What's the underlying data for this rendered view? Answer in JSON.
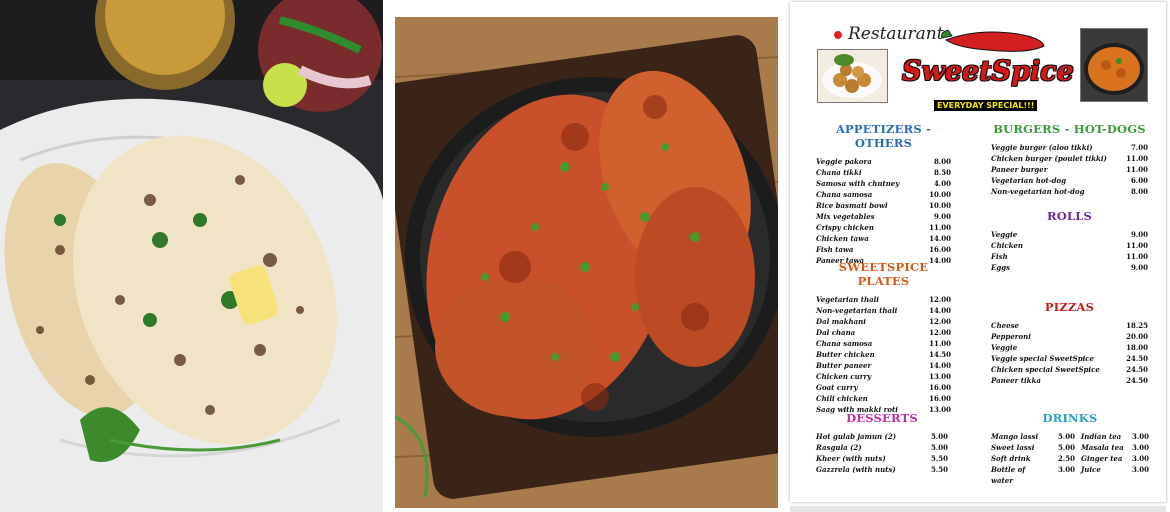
{
  "menu": {
    "header_label": "Restaurant",
    "logo": "SweetSpice",
    "tagline": "EVERYDAY SPECIAL!!!",
    "colors": {
      "blue": "#2a6db5",
      "green": "#3a9a3a",
      "purple": "#6a2aa0",
      "orange": "#d45a15",
      "red": "#c41a1a",
      "magenta": "#c32aa5",
      "cyan": "#2aa0c8"
    },
    "appetizers": {
      "title": "APPETIZERS - OTHERS",
      "items": [
        {
          "name": "Veggie pakora",
          "price": "8.00"
        },
        {
          "name": "Chana tikki",
          "price": "8.50"
        },
        {
          "name": "Samosa with chutney",
          "price": "4.00"
        },
        {
          "name": "Chana samosa",
          "price": "10.00"
        },
        {
          "name": "Rice basmati bowl",
          "price": "10.00"
        },
        {
          "name": "Mix vegetables",
          "price": "9.00"
        },
        {
          "name": "Crispy chicken",
          "price": "11.00"
        },
        {
          "name": "Chicken tawa",
          "price": "14.00"
        },
        {
          "name": "Fish tawa",
          "price": "16.00"
        },
        {
          "name": "Paneer tawa",
          "price": "14.00"
        }
      ]
    },
    "burgers": {
      "title": "BURGERS - HOT-DOGS",
      "items": [
        {
          "name": "Veggie burger (aloo tikki)",
          "price": "7.00"
        },
        {
          "name": "Chicken burger (poulet tikki)",
          "price": "11.00"
        },
        {
          "name": "Paneer burger",
          "price": "11.00"
        },
        {
          "name": "Vegetarian hot-dog",
          "price": "6.00"
        },
        {
          "name": "Non-vegetarian hot-dog",
          "price": "8.00"
        }
      ]
    },
    "rolls": {
      "title": "ROLLS",
      "items": [
        {
          "name": "Veggie",
          "price": "9.00"
        },
        {
          "name": "Chicken",
          "price": "11.00"
        },
        {
          "name": "Fish",
          "price": "11.00"
        },
        {
          "name": "Eggs",
          "price": "9.00"
        }
      ]
    },
    "plates": {
      "title": "SWEETSPICE PLATES",
      "items": [
        {
          "name": "Vegetarian thali",
          "price": "12.00"
        },
        {
          "name": "Non-vegetarian thali",
          "price": "14.00"
        },
        {
          "name": "Dal makhani",
          "price": "12.00"
        },
        {
          "name": "Dal chana",
          "price": "12.00"
        },
        {
          "name": "Chana samosa",
          "price": "11.00"
        },
        {
          "name": "Butter chicken",
          "price": "14.50"
        },
        {
          "name": "Butter paneer",
          "price": "14.00"
        },
        {
          "name": "Chicken curry",
          "price": "13.00"
        },
        {
          "name": "Goat curry",
          "price": "16.00"
        },
        {
          "name": "Chili chicken",
          "price": "16.00"
        },
        {
          "name": "Saag with makki roti",
          "price": "13.00"
        }
      ]
    },
    "pizzas": {
      "title": "PIZZAS",
      "items": [
        {
          "name": "Cheese",
          "price": "18.25"
        },
        {
          "name": "Pepperoni",
          "price": "20.00"
        },
        {
          "name": "Veggie",
          "price": "18.00"
        },
        {
          "name": "Veggie special SweetSpice",
          "price": "24.50"
        },
        {
          "name": "Chicken special SweetSpice",
          "price": "24.50"
        },
        {
          "name": "Paneer tikka",
          "price": "24.50"
        }
      ]
    },
    "desserts": {
      "title": "DESSERTS",
      "items": [
        {
          "name": "Hot gulab jamun (2)",
          "price": "5.00"
        },
        {
          "name": "Rasgula (2)",
          "price": "5.00"
        },
        {
          "name": "Kheer (with nuts)",
          "price": "5.50"
        },
        {
          "name": "Gazzrela (with nuts)",
          "price": "5.50"
        }
      ]
    },
    "drinks": {
      "title": "DRINKS",
      "items": [
        {
          "name": "Mango lassi",
          "price": "5.00"
        },
        {
          "name": "Indian tea",
          "price": "3.00"
        },
        {
          "name": "Sweet lassi",
          "price": "5.00"
        },
        {
          "name": "Masala tea",
          "price": "3.00"
        },
        {
          "name": "Soft drink",
          "price": "2.50"
        },
        {
          "name": "Ginger tea",
          "price": "3.00"
        },
        {
          "name": "Bottle of water",
          "price": "3.00"
        },
        {
          "name": "Juice",
          "price": "3.00"
        }
      ]
    }
  },
  "photos": {
    "left_icon": "naan-bread-photo",
    "middle_icon": "tandoori-chicken-photo"
  }
}
